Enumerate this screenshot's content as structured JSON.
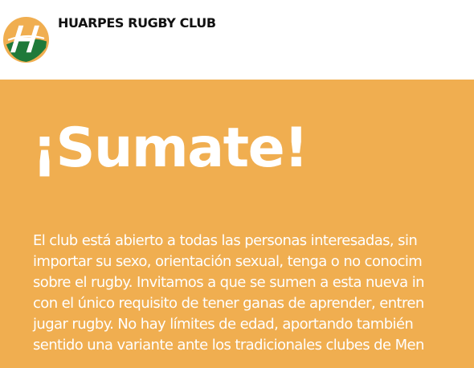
{
  "header": {
    "logo_icon": "huarpes-h-logo-icon",
    "brand_name": "HUARPES RUGBY CLUB",
    "colors": {
      "logo_orange": "#f0ae50",
      "logo_green": "#1f7a3a",
      "brand_text": "#111111"
    }
  },
  "hero": {
    "title": "¡Sumate!",
    "lines": [
      "El club está abierto a todas las personas interesadas, sin",
      "importar su sexo, orientación sexual, tenga o no conocim",
      "sobre el rugby. Invitamos a que se sumen a esta nueva in",
      "con el único requisito de tener ganas de aprender, entren",
      "jugar rugby. No hay límites de edad, aportando también",
      "sentido una variante ante los tradicionales clubes de Men"
    ],
    "colors": {
      "background": "#f0ae50",
      "text": "#ffffff"
    }
  }
}
